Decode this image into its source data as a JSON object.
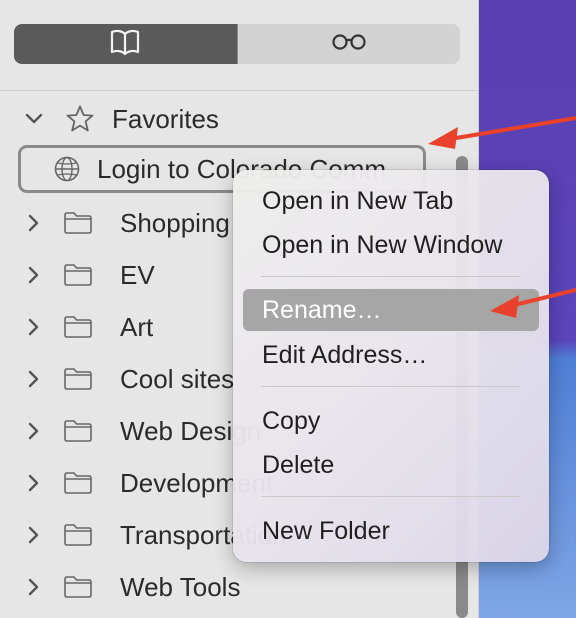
{
  "segmented_control": {
    "bookmarks_icon": "book-icon",
    "reading_list_icon": "glasses-icon"
  },
  "favorites": {
    "label": "Favorites"
  },
  "bookmark_selected": {
    "label": "Login to Colorado Comm"
  },
  "folders": [
    {
      "label": "Shopping"
    },
    {
      "label": "EV"
    },
    {
      "label": "Art"
    },
    {
      "label": "Cool sites"
    },
    {
      "label": "Web Design"
    },
    {
      "label": "Development"
    },
    {
      "label": "Transportation"
    },
    {
      "label": "Web Tools"
    }
  ],
  "context_menu": {
    "open_new_tab": "Open in New Tab",
    "open_new_window": "Open in New Window",
    "rename": "Rename…",
    "edit_address": "Edit Address…",
    "copy": "Copy",
    "delete": "Delete",
    "new_folder": "New Folder"
  },
  "colors": {
    "annotation_arrow": "#e8412c",
    "menu_highlight": "#a6a6a6"
  }
}
